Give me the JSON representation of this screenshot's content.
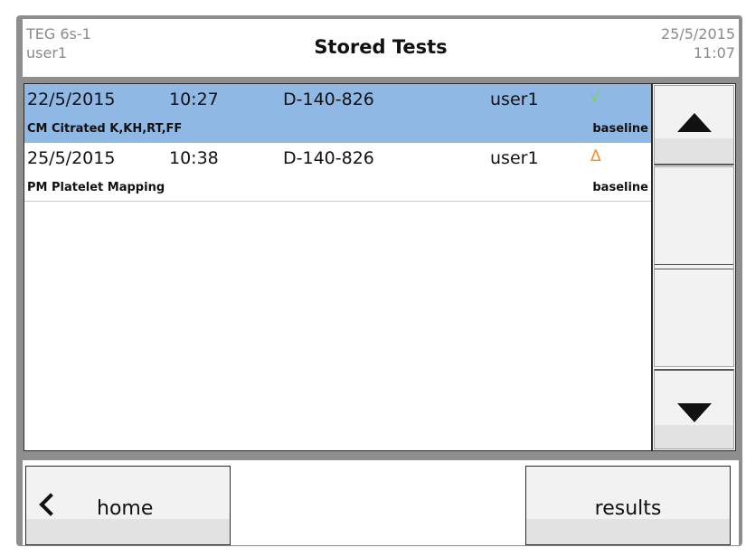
{
  "header": {
    "device": "TEG 6s-1",
    "user": "user1",
    "title": "Stored Tests",
    "date": "25/5/2015",
    "time": "11:07"
  },
  "tests": [
    {
      "date": "22/5/2015",
      "time": "10:27",
      "id": "D-140-826",
      "user": "user1",
      "status_symbol": "√",
      "status": "ok",
      "description": "CM Citrated K,KH,RT,FF",
      "tag": "baseline",
      "selected": true
    },
    {
      "date": "25/5/2015",
      "time": "10:38",
      "id": "D-140-826",
      "user": "user1",
      "status_symbol": "Δ",
      "status": "warning",
      "description": "PM Platelet Mapping",
      "tag": "baseline",
      "selected": false
    }
  ],
  "scrollbar": {
    "up_icon": "triangle-up-icon",
    "down_icon": "triangle-down-icon"
  },
  "footer": {
    "home_label": "home",
    "home_icon": "chevron-left-icon",
    "results_label": "results"
  },
  "colors": {
    "selected_row": "#8fb8e4",
    "status_ok": "#6cdc3c",
    "status_warning": "#ff8a1e",
    "frame": "#8e8e8e"
  }
}
